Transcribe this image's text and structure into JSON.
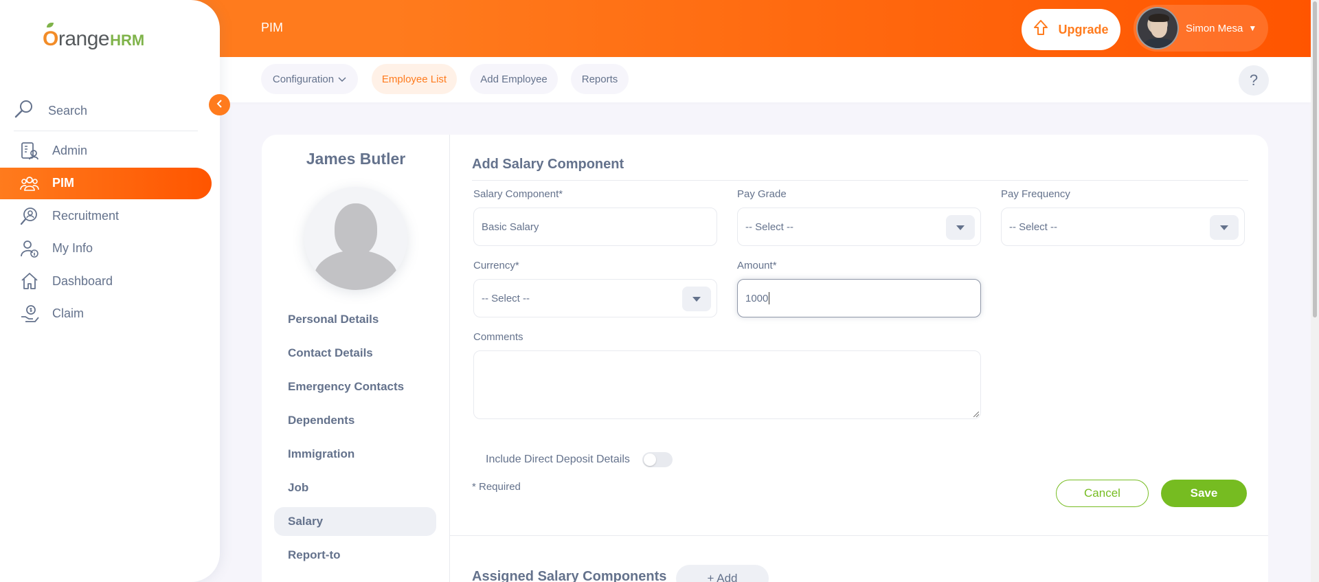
{
  "brand": {
    "logo_text": "range",
    "logo_o": "O",
    "logo_hrm": "HRM"
  },
  "sidebar": {
    "search_label": "Search",
    "items": [
      {
        "label": "Admin",
        "icon": "admin-icon",
        "active": false
      },
      {
        "label": "PIM",
        "icon": "pim-icon",
        "active": true
      },
      {
        "label": "Recruitment",
        "icon": "recruitment-icon",
        "active": false
      },
      {
        "label": "My Info",
        "icon": "my-info-icon",
        "active": false
      },
      {
        "label": "Dashboard",
        "icon": "dashboard-icon",
        "active": false
      },
      {
        "label": "Claim",
        "icon": "claim-icon",
        "active": false
      }
    ]
  },
  "header": {
    "module_title": "PIM",
    "upgrade_label": "Upgrade",
    "user_name": "Simon Mesa"
  },
  "subnav": {
    "tabs": [
      {
        "label": "Configuration",
        "active": false,
        "has_dropdown": true
      },
      {
        "label": "Employee List",
        "active": true,
        "has_dropdown": false
      },
      {
        "label": "Add Employee",
        "active": false,
        "has_dropdown": false
      },
      {
        "label": "Reports",
        "active": false,
        "has_dropdown": false
      }
    ],
    "help_label": "?"
  },
  "employee": {
    "name": "James Butler",
    "menu": [
      {
        "label": "Personal Details",
        "active": false
      },
      {
        "label": "Contact Details",
        "active": false
      },
      {
        "label": "Emergency Contacts",
        "active": false
      },
      {
        "label": "Dependents",
        "active": false
      },
      {
        "label": "Immigration",
        "active": false
      },
      {
        "label": "Job",
        "active": false
      },
      {
        "label": "Salary",
        "active": true
      },
      {
        "label": "Report-to",
        "active": false
      }
    ]
  },
  "form": {
    "title": "Add Salary Component",
    "salary_component": {
      "label": "Salary Component*",
      "value": "Basic Salary"
    },
    "pay_grade": {
      "label": "Pay Grade",
      "value": "-- Select --"
    },
    "pay_frequency": {
      "label": "Pay Frequency",
      "value": "-- Select --"
    },
    "currency": {
      "label": "Currency*",
      "value": "-- Select --"
    },
    "amount": {
      "label": "Amount*",
      "value": "1000"
    },
    "comments": {
      "label": "Comments",
      "value": ""
    },
    "direct_deposit_label": "Include Direct Deposit Details",
    "direct_deposit_on": false,
    "required_note": "* Required",
    "cancel_label": "Cancel",
    "save_label": "Save"
  },
  "assigned": {
    "title": "Assigned Salary Components",
    "add_label": "+ Add"
  },
  "colors": {
    "accent": "#ff7b1d",
    "success": "#76bc21",
    "text": "#64728c"
  }
}
